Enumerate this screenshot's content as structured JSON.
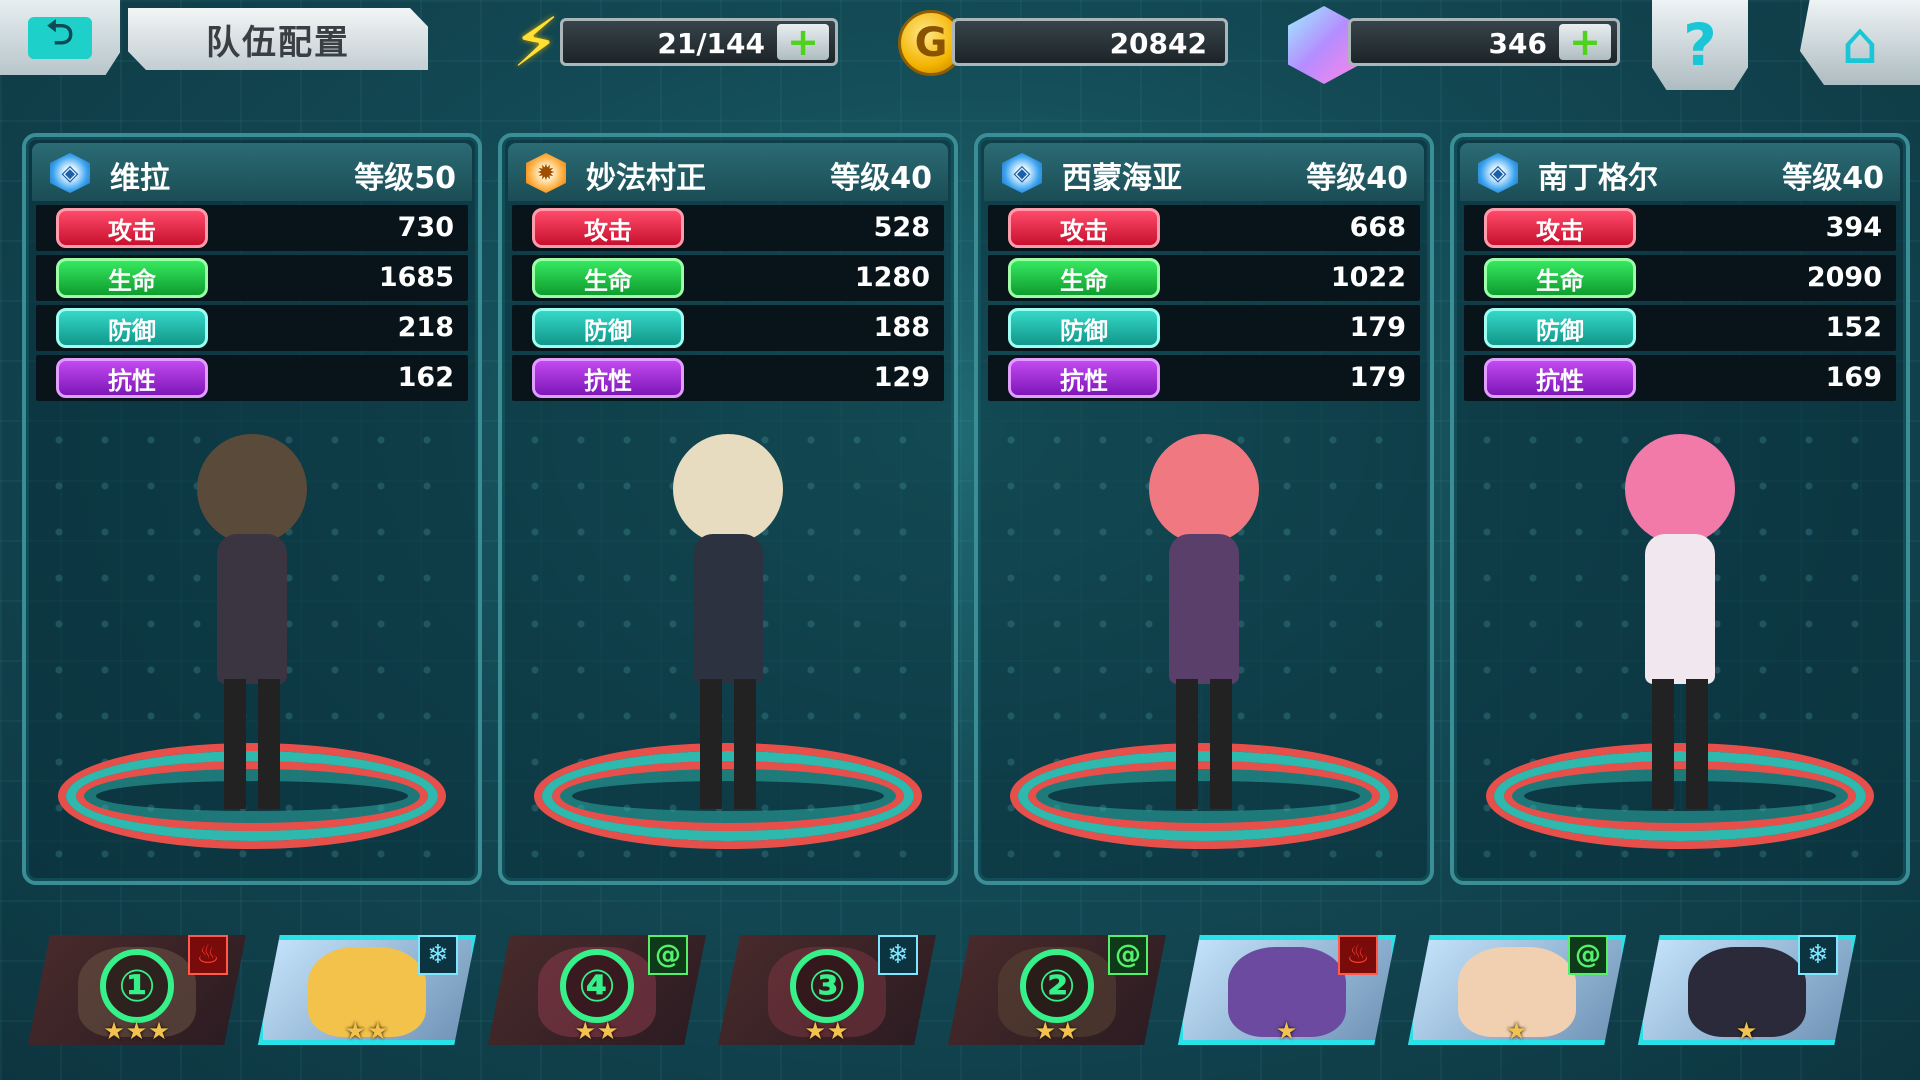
{
  "header": {
    "back_icon": "back-arrow-icon",
    "title": "队伍配置",
    "help_glyph": "?",
    "home_icon": "home-icon"
  },
  "resources": {
    "energy": {
      "value": "21/144",
      "icon": "lightning-bolt-icon"
    },
    "gold": {
      "value": "20842",
      "icon": "gold-coin-icon",
      "glyph": "G"
    },
    "gems": {
      "value": "346",
      "icon": "crystal-gem-icon"
    },
    "plus_glyph": "+"
  },
  "stat_labels": {
    "atk": "攻击",
    "hp": "生命",
    "def": "防御",
    "res": "抗性"
  },
  "characters": [
    {
      "name": "维拉",
      "level": "等级50",
      "element": "water",
      "atk": "730",
      "hp": "1685",
      "def": "218",
      "res": "162"
    },
    {
      "name": "妙法村正",
      "level": "等级40",
      "element": "fire",
      "atk": "528",
      "hp": "1280",
      "def": "188",
      "res": "129"
    },
    {
      "name": "西蒙海亚",
      "level": "等级40",
      "element": "water",
      "atk": "668",
      "hp": "1022",
      "def": "179",
      "res": "179"
    },
    {
      "name": "南丁格尔",
      "level": "等级40",
      "element": "water",
      "atk": "394",
      "hp": "2090",
      "def": "152",
      "res": "169"
    }
  ],
  "roster": [
    {
      "slot_number": "①",
      "stars": "★★★",
      "element": "fire",
      "element_glyph": "♨"
    },
    {
      "slot_number": "",
      "stars": "★★",
      "element": "ice",
      "element_glyph": "❄"
    },
    {
      "slot_number": "④",
      "stars": "★★",
      "element": "wind",
      "element_glyph": "@"
    },
    {
      "slot_number": "③",
      "stars": "★★",
      "element": "ice",
      "element_glyph": "❄"
    },
    {
      "slot_number": "②",
      "stars": "★★",
      "element": "wind",
      "element_glyph": "@"
    },
    {
      "slot_number": "",
      "stars": "★",
      "element": "fire",
      "element_glyph": "♨"
    },
    {
      "slot_number": "",
      "stars": "★",
      "element": "wind",
      "element_glyph": "@"
    },
    {
      "slot_number": "",
      "stars": "★",
      "element": "ice",
      "element_glyph": "❄"
    }
  ],
  "colors": {
    "accent": "#1dd0c9",
    "frame": "#3c8e96",
    "selected_frame": "#29e2e8"
  }
}
